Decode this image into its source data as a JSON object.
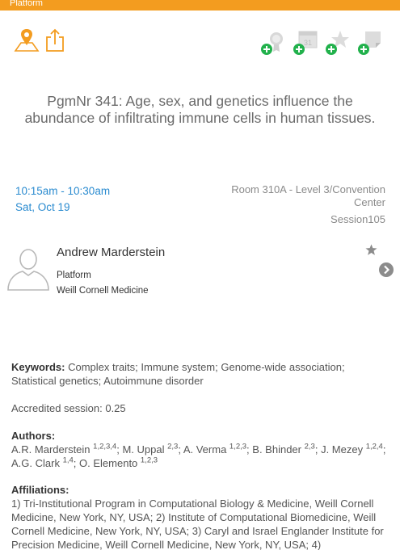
{
  "topbar": {
    "label": "Platform",
    "color": "#f39c1f"
  },
  "toolbar": {
    "icons": [
      "map-pin-icon",
      "share-icon",
      "add-speaker-icon",
      "add-calendar-icon",
      "add-favorite-icon",
      "add-note-icon"
    ]
  },
  "session": {
    "title": "PgmNr 341: Age, sex, and genetics influence the abundance of infiltrating immune cells in human tissues.",
    "time": "10:15am - 10:30am",
    "date": "Sat, Oct 19",
    "room": "Room 310A - Level 3/Convention Center",
    "session_label": "Session105"
  },
  "speaker": {
    "name": "Andrew Marderstein",
    "role": "Platform",
    "affiliation": "Weill Cornell Medicine"
  },
  "details": {
    "keywords_label": "Keywords:",
    "keywords": "Complex traits; Immune system; Genome-wide association; Statistical genetics; Autoimmune disorder",
    "accredited": "Accredited session: 0.25",
    "authors_label": "Authors:",
    "authors": [
      {
        "name": "A.R. Marderstein",
        "sup": "1,2,3,4"
      },
      {
        "name": "M. Uppal",
        "sup": "2,3"
      },
      {
        "name": "A. Verma",
        "sup": "1,2,3"
      },
      {
        "name": "B. Bhinder",
        "sup": "2,3"
      },
      {
        "name": "J. Mezey",
        "sup": "1,2,4"
      },
      {
        "name": "A.G. Clark",
        "sup": "1,4"
      },
      {
        "name": "O. Elemento",
        "sup": "1,2,3"
      }
    ],
    "affiliations_label": "Affiliations:",
    "affiliations": "1) Tri-Institutional Program in Computational Biology & Medicine, Weill Cornell Medicine, New York, NY, USA; 2) Institute of Computational Biomedicine, Weill Cornell Medicine, New York, NY, USA; 3) Caryl and Israel Englander Institute for Precision Medicine, Weill Cornell Medicine, New York, NY, USA; 4)"
  },
  "colors": {
    "accent": "#f39c1f",
    "link": "#2a8bd0",
    "add": "#22b14c"
  }
}
